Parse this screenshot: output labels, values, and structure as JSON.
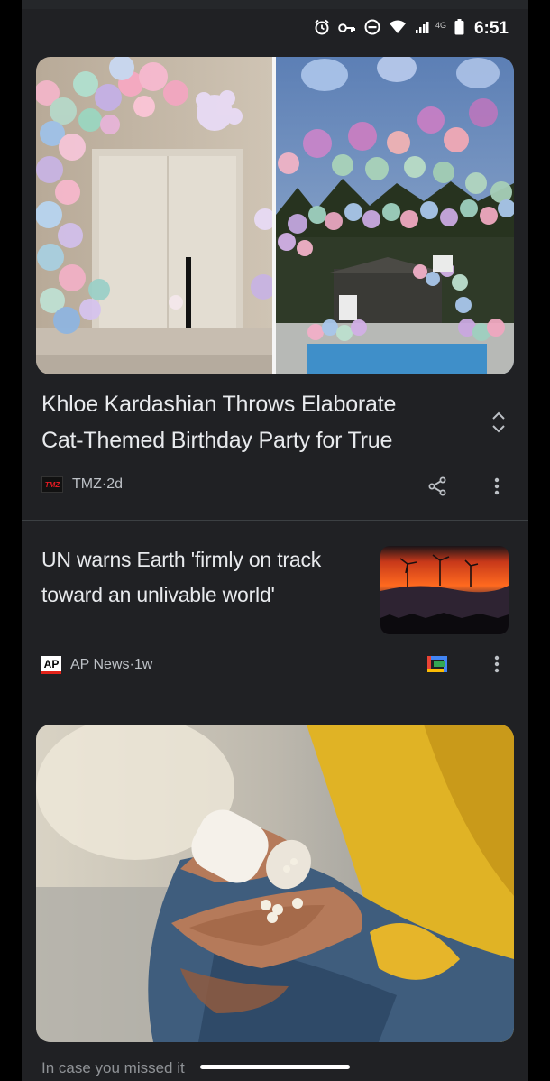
{
  "status_bar": {
    "time": "6:51",
    "network": "4G"
  },
  "articles": [
    {
      "headline_line1": "Khloe Kardashian Throws Elaborate",
      "headline_line2": "Cat-Themed Birthday Party for True",
      "source": "TMZ",
      "source_logo": "TMZ",
      "age": "2d",
      "image": "balloon-party-photo"
    },
    {
      "headline_line1": "UN warns Earth 'firmly on track",
      "headline_line2": "toward an unlivable world'",
      "source": "AP News",
      "source_logo": "AP",
      "age": "1w",
      "image": "wind-turbines-sunset-thumbnail"
    },
    {
      "image": "hand-pouring-pills-photo"
    }
  ],
  "section_header": "In case you missed it",
  "separator": " · ",
  "colors": {
    "background": "#202124",
    "text": "#e8eaed",
    "secondary_text": "#bdc1c6",
    "tmz_red": "#e31b23"
  }
}
